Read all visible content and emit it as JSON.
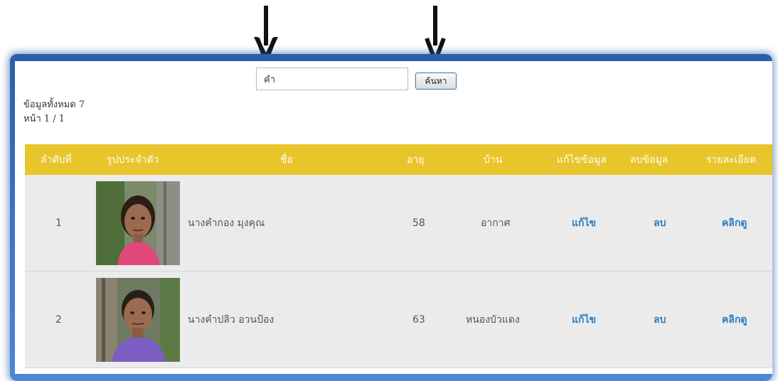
{
  "search": {
    "value": "คำ",
    "button_label": "ค้นหา"
  },
  "summary": {
    "total_text": "ข้อมูลทั้งหมด 7",
    "page_text": "หน้า 1 / 1"
  },
  "table": {
    "headers": [
      "ลำดับที่",
      "รูปประจำตัว",
      "ชื่อ",
      "อายุ",
      "บ้าน",
      "แก้ไขข้อมูล",
      "ลบข้อมูล",
      "รายละเอียด"
    ],
    "rows": [
      {
        "no": "1",
        "name": "นางคำกอง มุงคุณ",
        "age": "58",
        "village": "อากาศ",
        "edit": "แก้ไข",
        "delete": "ลบ",
        "detail": "คลิกดู"
      },
      {
        "no": "2",
        "name": "นางคำปลิว อวนป้อง",
        "age": "63",
        "village": "หนองบัวแดง",
        "edit": "แก้ไข",
        "delete": "ลบ",
        "detail": "คลิกดู"
      }
    ]
  },
  "colors": {
    "header_bg": "#e8c52a",
    "link": "#2a7bc0",
    "frame": "#3a72c4",
    "row_bg": "#ebebeb"
  },
  "icons": {
    "annotation_arrows": [
      "down-arrow-icon",
      "down-arrow-icon"
    ]
  }
}
